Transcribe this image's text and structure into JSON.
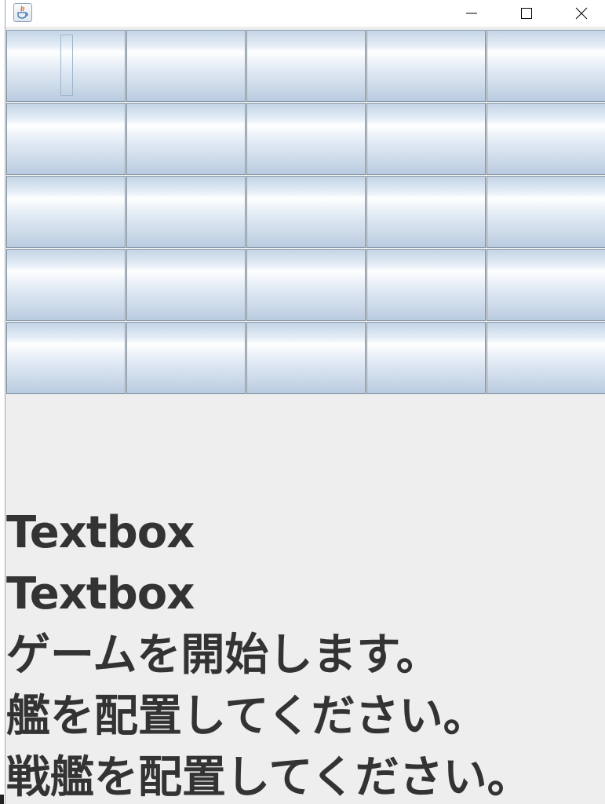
{
  "window": {
    "icon": "java-cup-icon",
    "controls": {
      "minimize": "minimize-icon",
      "maximize": "maximize-icon",
      "close": "close-icon"
    }
  },
  "grid": {
    "rows": 5,
    "columns": 5,
    "focused_cell": [
      0,
      0
    ]
  },
  "messages": [
    "Textbox",
    "Textbox",
    "ゲームを開始します。",
    "艦を配置してください。",
    "戦艦を配置してください。"
  ],
  "colors": {
    "window_background": "#eeeeee",
    "text": "#333333",
    "button_border": "#7a8a99",
    "button_gradient_top": "#c3d4e6",
    "button_gradient_highlight": "#ffffff"
  }
}
